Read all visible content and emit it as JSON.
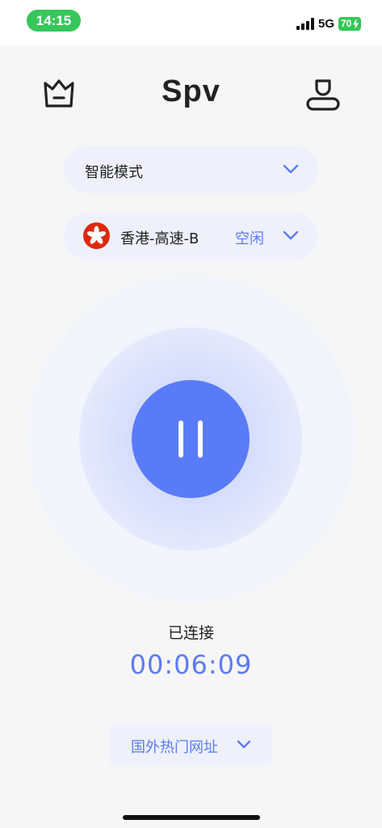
{
  "status_bar": {
    "time": "14:15",
    "network": "5G",
    "battery": "70"
  },
  "header": {
    "title": "Spv",
    "left_icon": "crown-icon",
    "right_icon": "user-icon"
  },
  "mode_selector": {
    "label": "智能模式",
    "icon": "chevron-down-icon"
  },
  "server_selector": {
    "flag": "hong-kong-flag-icon",
    "label": "香港-高速-B",
    "status": "空闲",
    "icon": "chevron-down-icon"
  },
  "connection": {
    "button_icon": "pause-icon",
    "status_text": "已连接",
    "elapsed": "00:06:09"
  },
  "popular_sites": {
    "label": "国外热门网址",
    "icon": "chevron-down-icon"
  },
  "colors": {
    "accent": "#5a7bf8",
    "accent_text": "#5b7bf4",
    "pill_bg": "#eef1fb",
    "status_green": "#35c759",
    "background": "#f6f6f7"
  }
}
